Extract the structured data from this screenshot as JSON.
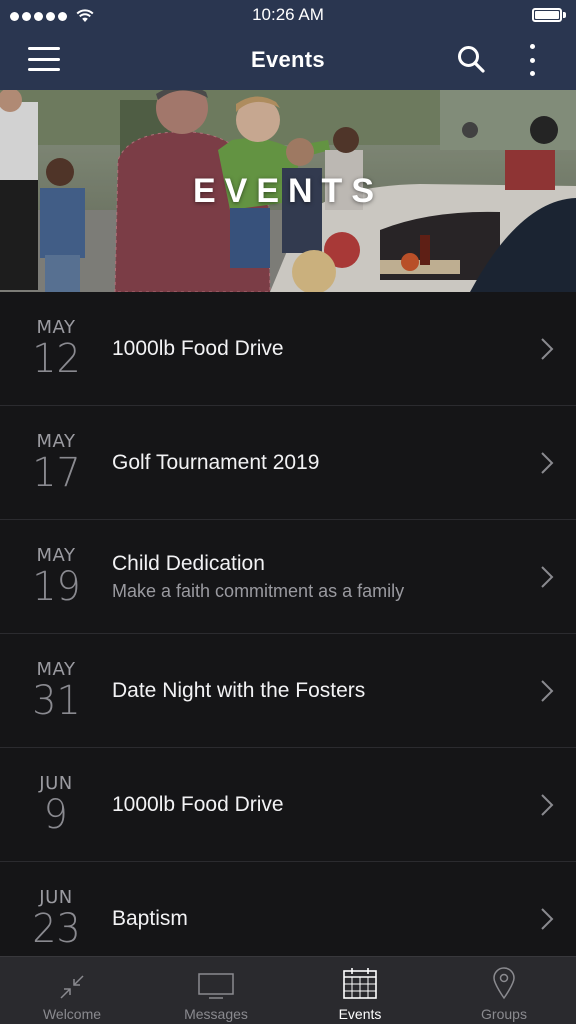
{
  "status_bar": {
    "time": "10:26 AM",
    "signal_bars": 5
  },
  "nav": {
    "title": "Events",
    "left_icon": "hamburger-menu-icon",
    "right_icons": [
      "search-icon",
      "more-vertical-icon"
    ]
  },
  "hero": {
    "title": "EVENTS"
  },
  "events": [
    {
      "month": "MAY",
      "day": "12",
      "title": "1000lb Food Drive",
      "subtitle": ""
    },
    {
      "month": "MAY",
      "day": "17",
      "title": "Golf Tournament 2019",
      "subtitle": ""
    },
    {
      "month": "MAY",
      "day": "19",
      "title": "Child Dedication",
      "subtitle": "Make a faith commitment as a family"
    },
    {
      "month": "MAY",
      "day": "31",
      "title": "Date Night with the Fosters",
      "subtitle": ""
    },
    {
      "month": "JUN",
      "day": "9",
      "title": "1000lb Food Drive",
      "subtitle": ""
    },
    {
      "month": "JUN",
      "day": "23",
      "title": "Baptism",
      "subtitle": ""
    }
  ],
  "tabs": [
    {
      "label": "Welcome",
      "icon": "compress-arrows-icon",
      "active": false
    },
    {
      "label": "Messages",
      "icon": "monitor-icon",
      "active": false
    },
    {
      "label": "Events",
      "icon": "calendar-icon",
      "active": true
    },
    {
      "label": "Groups",
      "icon": "map-pin-icon",
      "active": false
    }
  ],
  "colors": {
    "header_bg": "#2a3650",
    "list_bg": "#151517",
    "tab_bar_bg": "#2a2a2e",
    "active_tab": "#ffffff",
    "inactive_tab": "#8a8a8f"
  }
}
